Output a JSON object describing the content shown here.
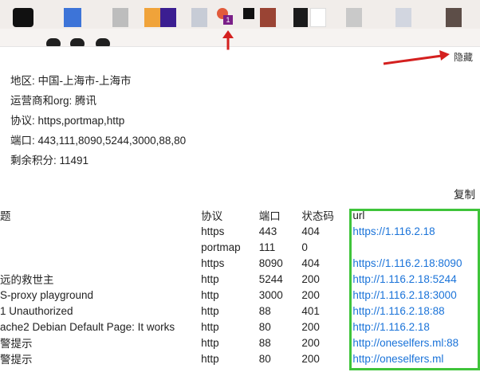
{
  "extension": {
    "badge_count": "1"
  },
  "panel": {
    "hide_label": "隐藏",
    "copy_label": "复制",
    "info": {
      "region": "地区: 中国-上海市-上海市",
      "isp": "运营商和org: 腾讯",
      "protocols": "协议: https,portmap,http",
      "ports": "端口: 443,111,8090,5244,3000,88,80",
      "credits": "剩余积分: 11491"
    },
    "table": {
      "headers": [
        "题",
        "协议",
        "端口",
        "状态码",
        "url"
      ],
      "rows": [
        [
          "",
          "https",
          "443",
          "404",
          "https://1.116.2.18"
        ],
        [
          "",
          "portmap",
          "111",
          "0",
          ""
        ],
        [
          "",
          "https",
          "8090",
          "404",
          "https://1.116.2.18:8090"
        ],
        [
          "远的救世主",
          "http",
          "5244",
          "200",
          "http://1.116.2.18:5244"
        ],
        [
          "S-proxy playground",
          "http",
          "3000",
          "200",
          "http://1.116.2.18:3000"
        ],
        [
          "1 Unauthorized",
          "http",
          "88",
          "401",
          "http://1.116.2.18:88"
        ],
        [
          "ache2 Debian Default Page: It works",
          "http",
          "80",
          "200",
          "http://1.116.2.18"
        ],
        [
          "警提示",
          "http",
          "88",
          "200",
          "http://oneselfers.ml:88"
        ],
        [
          "警提示",
          "http",
          "80",
          "200",
          "http://oneselfers.ml"
        ]
      ]
    }
  },
  "colors": {
    "accent_link": "#1a73d9",
    "highlight_box": "#3fc43a",
    "arrow": "#d4201f",
    "badge": "#7a1f88"
  }
}
